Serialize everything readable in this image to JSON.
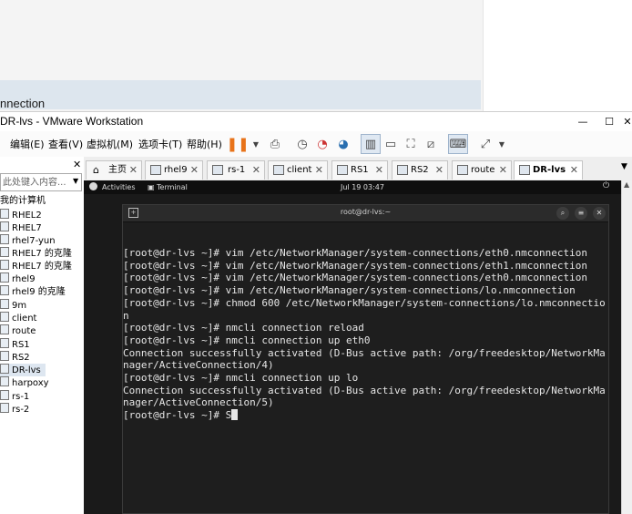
{
  "background_window": {
    "partial_text": "nnection"
  },
  "vmware": {
    "title": "DR-lvs - VMware Workstation",
    "menus": [
      "编辑(E)",
      "查看(V)",
      "虚拟机(M)",
      "选项卡(T)",
      "帮助(H)"
    ]
  },
  "library": {
    "search_placeholder": "此处键入内容...",
    "root": "我的计算机",
    "items": [
      "RHEL2",
      "RHEL7",
      "rhel7-yun",
      "RHEL7 的克隆",
      "RHEL7 的克隆",
      "rhel9",
      "rhel9 的克隆",
      "9m",
      "client",
      "route",
      "RS1",
      "RS2",
      "DR-lvs",
      "harpoxy",
      "rs-1",
      "rs-2"
    ]
  },
  "tabs": [
    {
      "label": "主页"
    },
    {
      "label": "rhel9"
    },
    {
      "label": "rs-1"
    },
    {
      "label": "client"
    },
    {
      "label": "RS1"
    },
    {
      "label": "RS2"
    },
    {
      "label": "route"
    },
    {
      "label": "DR-lvs"
    }
  ],
  "gnome": {
    "activities": "Activities",
    "app": "Terminal",
    "clock": "Jul 19  03:47"
  },
  "terminal": {
    "title": "root@dr-lvs:~",
    "lines": [
      "[root@dr-lvs ~]# vim /etc/NetworkManager/system-connections/eth0.nmconnection",
      "[root@dr-lvs ~]# vim /etc/NetworkManager/system-connections/eth1.nmconnection",
      "[root@dr-lvs ~]# vim /etc/NetworkManager/system-connections/eth0.nmconnection",
      "[root@dr-lvs ~]# vim /etc/NetworkManager/system-connections/lo.nmconnection",
      "[root@dr-lvs ~]# chmod 600 /etc/NetworkManager/system-connections/lo.nmconnectio",
      "n",
      "[root@dr-lvs ~]# nmcli connection reload",
      "[root@dr-lvs ~]# nmcli connection up eth0",
      "Connection successfully activated (D-Bus active path: /org/freedesktop/NetworkMa",
      "nager/ActiveConnection/4)",
      "[root@dr-lvs ~]# nmcli connection up lo",
      "Connection successfully activated (D-Bus active path: /org/freedesktop/NetworkMa",
      "nager/ActiveConnection/5)"
    ],
    "prompt": "[root@dr-lvs ~]# S"
  },
  "colors": {
    "accent_pause": "#e8731a",
    "terminal_bg": "#1e1e1e"
  }
}
